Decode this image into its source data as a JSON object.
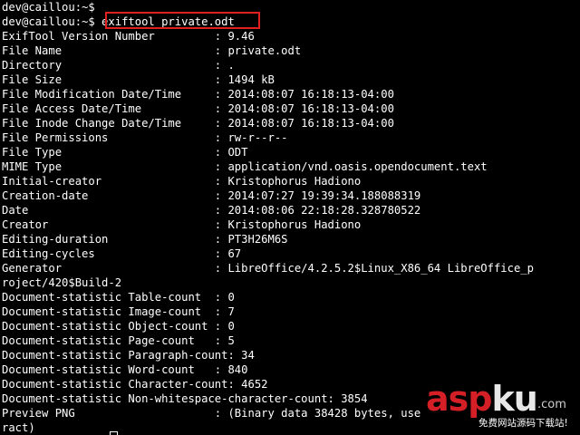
{
  "terminal": {
    "lines": [
      "dev@caillou:~$",
      "dev@caillou:~$ exiftool private.odt",
      "ExifTool Version Number         : 9.46",
      "File Name                       : private.odt",
      "Directory                       : .",
      "File Size                       : 1494 kB",
      "File Modification Date/Time     : 2014:08:07 16:18:13-04:00",
      "File Access Date/Time           : 2014:08:07 16:18:13-04:00",
      "File Inode Change Date/Time     : 2014:08:07 16:18:13-04:00",
      "File Permissions                : rw-r--r--",
      "File Type                       : ODT",
      "MIME Type                       : application/vnd.oasis.opendocument.text",
      "Initial-creator                 : Kristophorus Hadiono",
      "Creation-date                   : 2014:07:27 19:39:34.188088319",
      "Date                            : 2014:08:06 22:18:28.328780522",
      "Creator                         : Kristophorus Hadiono",
      "Editing-duration                : PT3H26M6S",
      "Editing-cycles                  : 67",
      "Generator                       : LibreOffice/4.2.5.2$Linux_X86_64 LibreOffice_p",
      "roject/420$Build-2",
      "Document-statistic Table-count  : 0",
      "Document-statistic Image-count  : 7",
      "Document-statistic Object-count : 0",
      "Document-statistic Page-count   : 5",
      "Document-statistic Paragraph-count: 34",
      "Document-statistic Word-count   : 840",
      "Document-statistic Character-count: 4652",
      "Document-statistic Non-whitespace-character-count: 3854",
      "Preview PNG                     : (Binary data 38428 bytes, use",
      "ract)"
    ],
    "highlighted_command": "exiftool private.odt",
    "colors": {
      "background": "#000000",
      "text": "#ffffff",
      "highlight_border": "#e02020"
    }
  },
  "watermark": {
    "a": "a",
    "s": "s",
    "p": "p",
    "k": "k",
    "u": "u",
    "com": ".com",
    "subtitle": "免费网站源码下载站!",
    "colors": {
      "red": "#d51f26",
      "light": "#e8e8e8"
    }
  }
}
